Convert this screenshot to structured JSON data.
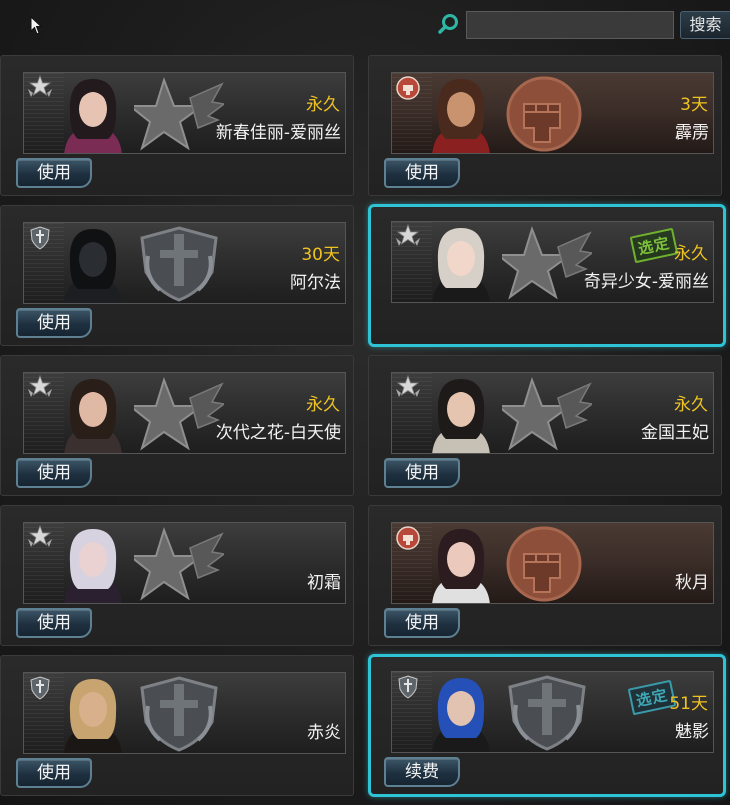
{
  "search": {
    "placeholder": "",
    "button_label": "搜索"
  },
  "colors": {
    "accent_selected": "#2fc3d6",
    "duration": "#f0c31f"
  },
  "cards": [
    {
      "name": "新春佳丽-爱丽丝",
      "duration": "永久",
      "button": "使用",
      "selected": false,
      "stamp": "",
      "theme": "gray",
      "rank_icon": "star-wings-icon",
      "emblem": "star-emblem-icon"
    },
    {
      "name": "霹雳",
      "duration": "3天",
      "button": "使用",
      "selected": false,
      "stamp": "",
      "theme": "red",
      "rank_icon": "fist-icon",
      "emblem": "fist-emblem-icon"
    },
    {
      "name": "阿尔法",
      "duration": "30天",
      "button": "使用",
      "selected": false,
      "stamp": "",
      "theme": "gray",
      "rank_icon": "sword-shield-icon",
      "emblem": "sword-emblem-icon"
    },
    {
      "name": "奇异少女-爱丽丝",
      "duration": "永久",
      "button": "",
      "selected": true,
      "stamp": "选定",
      "theme": "gray",
      "rank_icon": "star-wings-icon",
      "emblem": "star-emblem-icon"
    },
    {
      "name": "次代之花-白天使",
      "duration": "永久",
      "button": "使用",
      "selected": false,
      "stamp": "",
      "theme": "gray",
      "rank_icon": "star-wings-icon",
      "emblem": "star-emblem-icon"
    },
    {
      "name": "金国王妃",
      "duration": "永久",
      "button": "使用",
      "selected": false,
      "stamp": "",
      "theme": "gray",
      "rank_icon": "star-wings-icon",
      "emblem": "star-emblem-icon"
    },
    {
      "name": "初霜",
      "duration": "",
      "button": "使用",
      "selected": false,
      "stamp": "",
      "theme": "gray",
      "rank_icon": "star-wings-icon",
      "emblem": "star-emblem-icon"
    },
    {
      "name": "秋月",
      "duration": "",
      "button": "使用",
      "selected": false,
      "stamp": "",
      "theme": "red",
      "rank_icon": "fist-icon",
      "emblem": "fist-emblem-icon"
    },
    {
      "name": "赤炎",
      "duration": "",
      "button": "使用",
      "selected": false,
      "stamp": "",
      "theme": "gray",
      "rank_icon": "sword-shield-icon",
      "emblem": "sword-emblem-icon"
    },
    {
      "name": "魅影",
      "duration": "51天",
      "button": "续费",
      "selected": true,
      "stamp": "选定",
      "theme": "gray",
      "rank_icon": "sword-shield-icon",
      "emblem": "sword-emblem-icon"
    }
  ]
}
